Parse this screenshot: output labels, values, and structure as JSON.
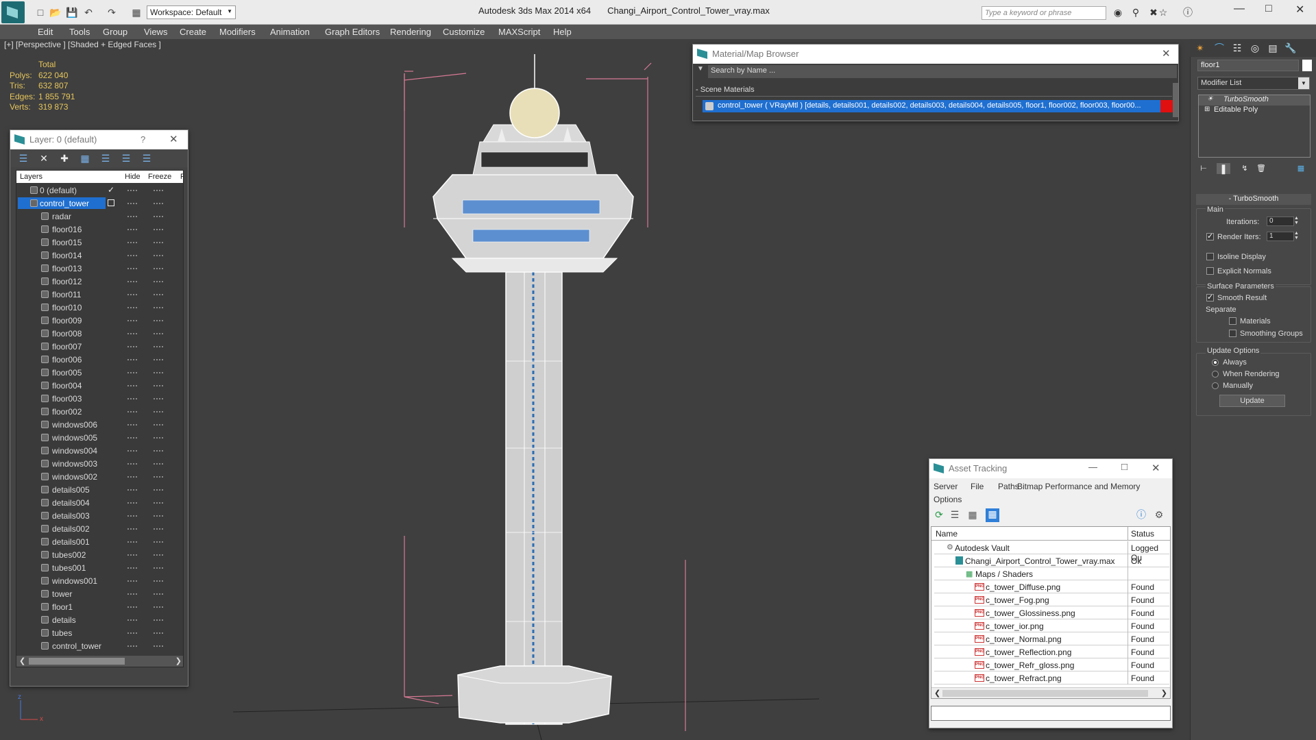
{
  "app": {
    "name": "Autodesk 3ds Max  2014 x64",
    "file": "Changi_Airport_Control_Tower_vray.max",
    "workspace": "Workspace: Default",
    "search_placeholder": "Type a keyword or phrase"
  },
  "menu": [
    "Edit",
    "Tools",
    "Group",
    "Views",
    "Create",
    "Modifiers",
    "Animation",
    "Graph Editors",
    "Rendering",
    "Customize",
    "MAXScript",
    "Help"
  ],
  "viewport": {
    "label": "[+] [Perspective ] [Shaded + Edged Faces ]",
    "stats": {
      "header": "Total",
      "rows": [
        {
          "k": "Polys:",
          "v": "622 040"
        },
        {
          "k": "Tris:",
          "v": "632 807"
        },
        {
          "k": "Edges:",
          "v": "1 855 791"
        },
        {
          "k": "Verts:",
          "v": "319 873"
        }
      ]
    }
  },
  "layer_panel": {
    "title": "Layer: 0 (default)",
    "help": "?",
    "cols": {
      "layers": "Layers",
      "hide": "Hide",
      "freeze": "Freeze",
      "render": "R"
    },
    "default_layer": "0 (default)",
    "active_layer": "control_tower",
    "items": [
      "radar",
      "floor016",
      "floor015",
      "floor014",
      "floor013",
      "floor012",
      "floor011",
      "floor010",
      "floor009",
      "floor008",
      "floor007",
      "floor006",
      "floor005",
      "floor004",
      "floor003",
      "floor002",
      "windows006",
      "windows005",
      "windows004",
      "windows003",
      "windows002",
      "details005",
      "details004",
      "details003",
      "details002",
      "details001",
      "tubes002",
      "tubes001",
      "windows001",
      "tower",
      "floor1",
      "details",
      "tubes",
      "control_tower"
    ]
  },
  "material_browser": {
    "title": "Material/Map Browser",
    "search": "Search by Name ...",
    "section": "Scene Materials",
    "material": "control_tower ( VRayMtl ) [details, details001, details002, details003, details004, details005, floor1, floor002, floor003, floor00..."
  },
  "asset_tracking": {
    "title": "Asset Tracking",
    "menu": [
      "Server",
      "File",
      "Paths",
      "Bitmap Performance and Memory",
      "Options"
    ],
    "cols": {
      "name": "Name",
      "status": "Status"
    },
    "rows": [
      {
        "name": "Autodesk Vault",
        "status": "Logged Ou",
        "indent": 1
      },
      {
        "name": "Changi_Airport_Control_Tower_vray.max",
        "status": "Ok",
        "indent": 2
      },
      {
        "name": "Maps / Shaders",
        "status": "",
        "indent": 3
      },
      {
        "name": "c_tower_Diffuse.png",
        "status": "Found",
        "indent": 4
      },
      {
        "name": "c_tower_Fog.png",
        "status": "Found",
        "indent": 4
      },
      {
        "name": "c_tower_Glossiness.png",
        "status": "Found",
        "indent": 4
      },
      {
        "name": "c_tower_ior.png",
        "status": "Found",
        "indent": 4
      },
      {
        "name": "c_tower_Normal.png",
        "status": "Found",
        "indent": 4
      },
      {
        "name": "c_tower_Reflection.png",
        "status": "Found",
        "indent": 4
      },
      {
        "name": "c_tower_Refr_gloss.png",
        "status": "Found",
        "indent": 4
      },
      {
        "name": "c_tower_Refract.png",
        "status": "Found",
        "indent": 4
      }
    ]
  },
  "command_panel": {
    "object_name": "floor1",
    "modifier_list": "Modifier List",
    "stack": [
      "TurboSmooth",
      "Editable Poly"
    ],
    "rollout": "TurboSmooth",
    "main": "Main",
    "iterations_label": "Iterations:",
    "iterations": "0",
    "render_iters_label": "Render Iters:",
    "render_iters": "1",
    "isoline": "Isoline Display",
    "explicit": "Explicit Normals",
    "surface": "Surface Parameters",
    "smooth": "Smooth Result",
    "separate": "Separate",
    "materials": "Materials",
    "smoothing_groups": "Smoothing Groups",
    "update_options": "Update Options",
    "always": "Always",
    "when_rendering": "When Rendering",
    "manually": "Manually",
    "update": "Update"
  },
  "axis": {
    "z": "z",
    "x": "x"
  },
  "colors": {
    "accent": "#1f6fd0",
    "stats": "#e6c65c",
    "selection": "#1f6fd0",
    "box": "#d87a96"
  }
}
